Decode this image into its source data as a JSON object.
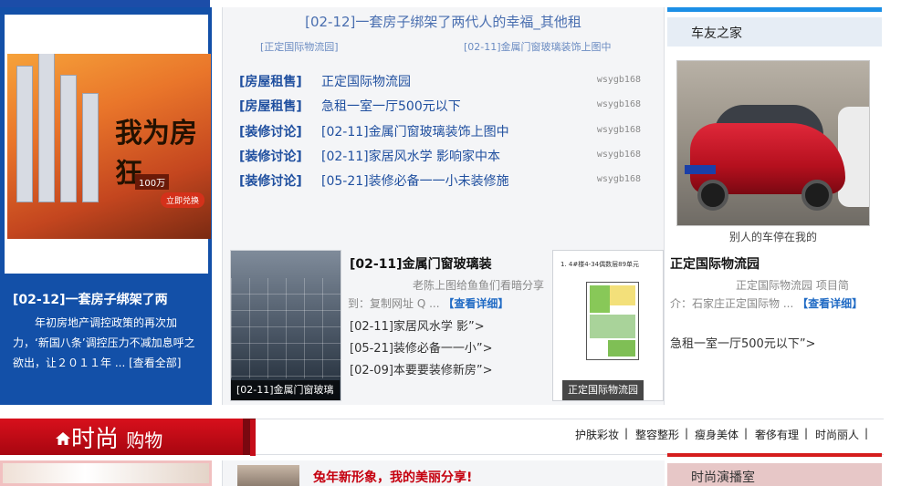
{
  "left": {
    "banner": {
      "big_text": "我为房狂",
      "amount": "100万",
      "button": "立即兑换"
    },
    "title": "[02-12]一套房子绑架了两",
    "desc": "年初房地产调控政策的再次加力，‘新国八条’调控压力不减加息呼之欲出，让２０１１年 ...",
    "more": "[查看全部]"
  },
  "middle": {
    "headline": "[02-12]一套房子绑架了两代人的幸福_其他租",
    "sub_links": [
      "[正定国际物流园]",
      "[02-11]金属门窗玻璃装饰上图中"
    ],
    "rows": [
      {
        "category": "[房屋租售]",
        "title": "正定国际物流园",
        "user": "wsygb168"
      },
      {
        "category": "[房屋租售]",
        "title": "急租一室一厅500元以下",
        "user": "wsygb168"
      },
      {
        "category": "[装修讨论]",
        "title": "[02-11]金属门窗玻璃装饰上图中",
        "user": "wsygb168"
      },
      {
        "category": "[装修讨论]",
        "title": "[02-11]家居风水学 影响家中本",
        "user": "wsygb168"
      },
      {
        "category": "[装修讨论]",
        "title": "[05-21]装修必备一一小未装修施",
        "user": "wsygb168"
      }
    ],
    "card1": {
      "caption": "[02-11]金属门窗玻璃",
      "title": "[02-11]金属门窗玻璃装",
      "text_line1": "老陈上图给鱼鱼们看暗分享",
      "text_line2": "到：复制网址 Q ...",
      "detail": "【查看详细】",
      "links": [
        "[02-11]家居风水学 影”>",
        "[05-21]装修必备一一小”>",
        "[02-09]本要要装修新房”>"
      ]
    },
    "card2": {
      "caption": "正定国际物流园",
      "plan_label": "1. 4#楼4-34偶数层89单元",
      "title": "正定国际物流园",
      "text_line1": "正定国际物流园 项目简",
      "text_line2": "介：石家庄正定国际物 ...",
      "detail": "【查看详细】",
      "link": "急租一室一厅500元以下”>"
    }
  },
  "right": {
    "header": "车友之家",
    "car_caption": "别人的车停在我的"
  },
  "fashion": {
    "title_big": "时尚",
    "title_small": "购物",
    "nav": [
      "护肤彩妆",
      "整容整形",
      "瘦身美体",
      "奢侈有理",
      "时尚丽人"
    ],
    "separator": "|",
    "headline": "兔年新形象，我的美丽分享!",
    "right_header": "时尚演播室"
  },
  "colors": {
    "primary_blue": "#1350a8",
    "link_blue": "#1f4f9f",
    "fashion_red": "#d8101c",
    "accent_sky": "#1c8fe6"
  }
}
